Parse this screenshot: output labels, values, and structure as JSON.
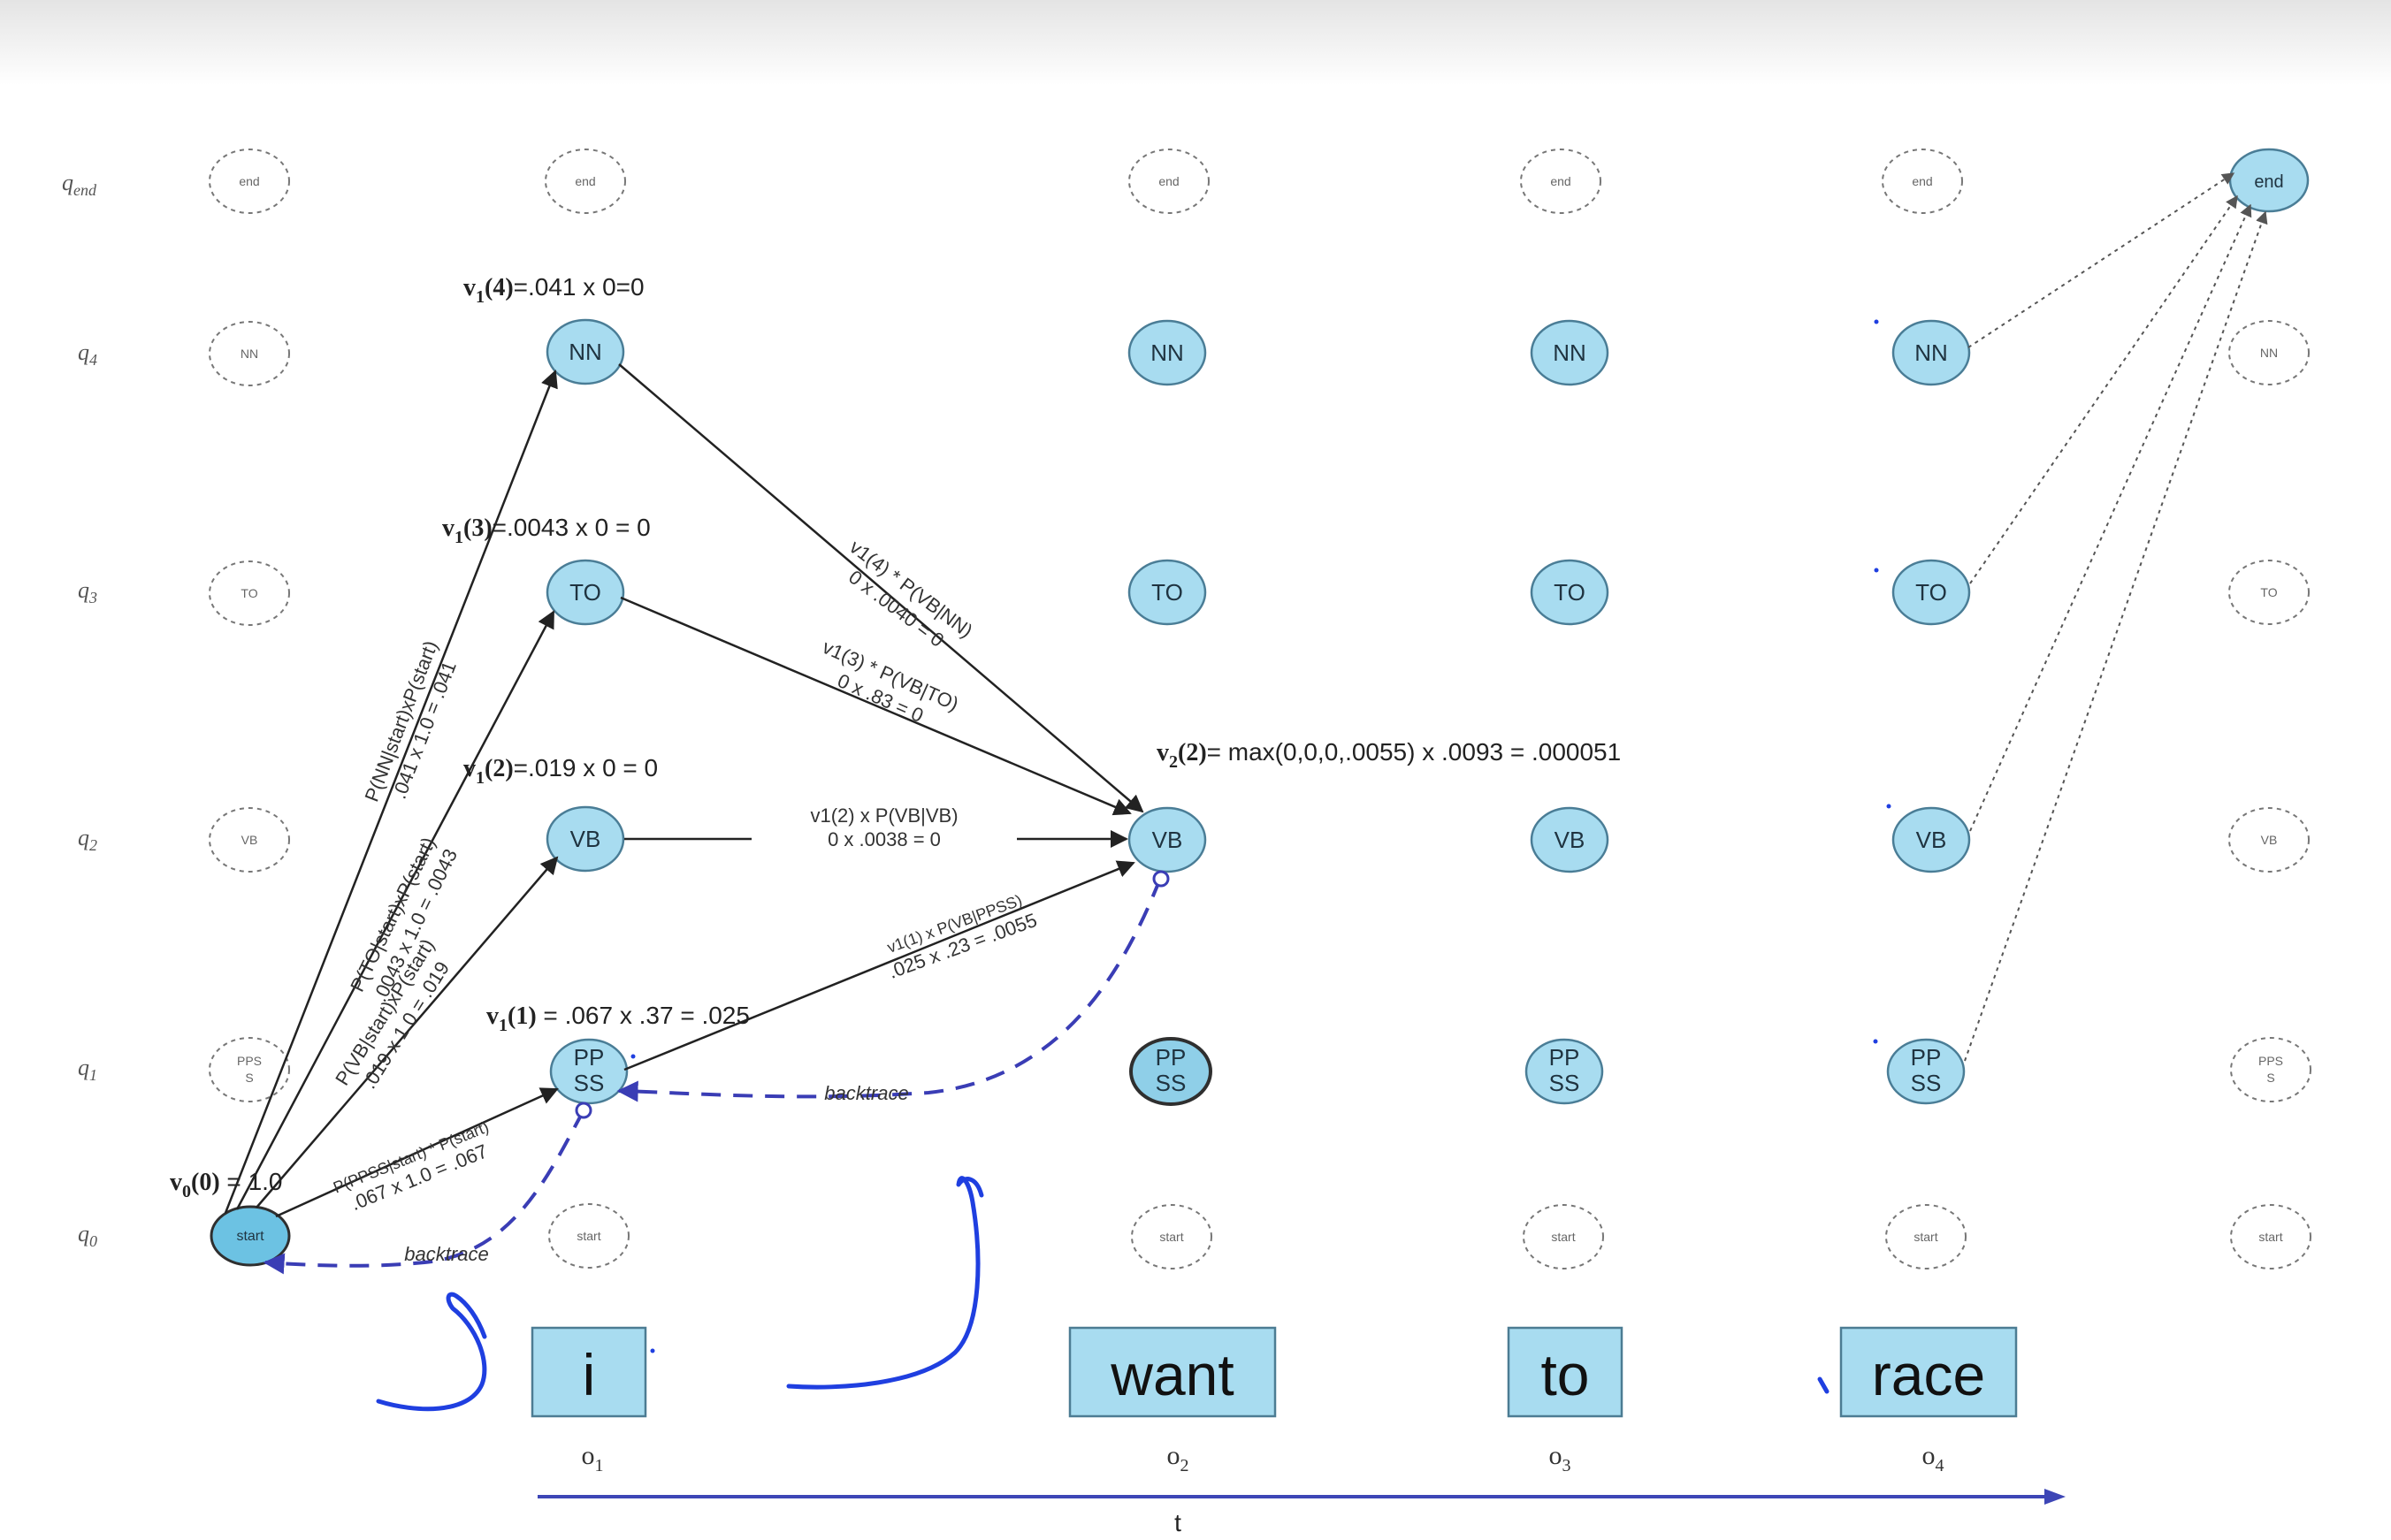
{
  "rows": [
    {
      "id": "qend",
      "base": "q",
      "sub": "end"
    },
    {
      "id": "q4",
      "base": "q",
      "sub": "4"
    },
    {
      "id": "q3",
      "base": "q",
      "sub": "3"
    },
    {
      "id": "q2",
      "base": "q",
      "sub": "2"
    },
    {
      "id": "q1",
      "base": "q",
      "sub": "1"
    },
    {
      "id": "q0",
      "base": "q",
      "sub": "0"
    }
  ],
  "state_labels": {
    "end": "end",
    "nn": "NN",
    "to": "TO",
    "vb": "VB",
    "pps_line1": "PPS",
    "pps_line2": "S",
    "ppss_line1": "PP",
    "ppss_line2": "SS",
    "start": "start"
  },
  "words": [
    "i",
    "want",
    "to",
    "race"
  ],
  "observations": [
    {
      "base": "o",
      "sub": "1"
    },
    {
      "base": "o",
      "sub": "2"
    },
    {
      "base": "o",
      "sub": "3"
    },
    {
      "base": "o",
      "sub": "4"
    }
  ],
  "time_axis_label": "t",
  "viterbi": {
    "v0": {
      "base": "v",
      "sub": "0",
      "arg": "(0)",
      "rest": " = 1.0"
    },
    "v1_4": {
      "base": "v",
      "sub": "1",
      "arg": "(4)",
      "rest": "=.041 x 0=0"
    },
    "v1_3": {
      "base": "v",
      "sub": "1",
      "arg": "(3)",
      "rest": "=.0043 x 0 = 0"
    },
    "v1_2": {
      "base": "v",
      "sub": "1",
      "arg": "(2)",
      "rest": "=.019 x 0 = 0"
    },
    "v1_1": {
      "base": "v",
      "sub": "1",
      "arg": "(1)",
      "rest": " = .067 x .37 = .025"
    },
    "v2_2": {
      "base": "v",
      "sub": "2",
      "arg": "(2)",
      "rest": "= max(0,0,0,.0055) x .0093 = .000051"
    }
  },
  "edge_labels": {
    "start_nn_1": "P(NN|start)xP(start)",
    "start_nn_2": ".041 x 1.0 = .041",
    "start_to_1": "P(TO|start)xP(start)",
    "start_to_2": ".0043 x 1.0 = .0043",
    "start_vb_1": "P(VB|start)xP(start)",
    "start_vb_2": ".019 x 1.0 = .019",
    "start_ppss_1": "P(PPSS|start) * P(start)",
    "start_ppss_2": ".067 x 1.0 = .067",
    "nn_vb_1": "v1(4) * P(VB|NN)",
    "nn_vb_2": "0 x .0040 = 0",
    "to_vb_1": "v1(3) * P(VB|TO)",
    "to_vb_2": "0 x .83 = 0",
    "vb_vb_1": "v1(2) x P(VB|VB)",
    "vb_vb_2": "0 x .0038 = 0",
    "ppss_vb_1": "v1(1) x P(VB|PPSS)",
    "ppss_vb_2": ".025 x .23 = .0055",
    "backtrace_1": "backtrace",
    "backtrace_2": "backtrace"
  },
  "colors": {
    "state_fill": "#a8dcf0",
    "backtrace": "#3a3db5",
    "ink": "#1f3fe0",
    "axis": "#3d46b6"
  }
}
